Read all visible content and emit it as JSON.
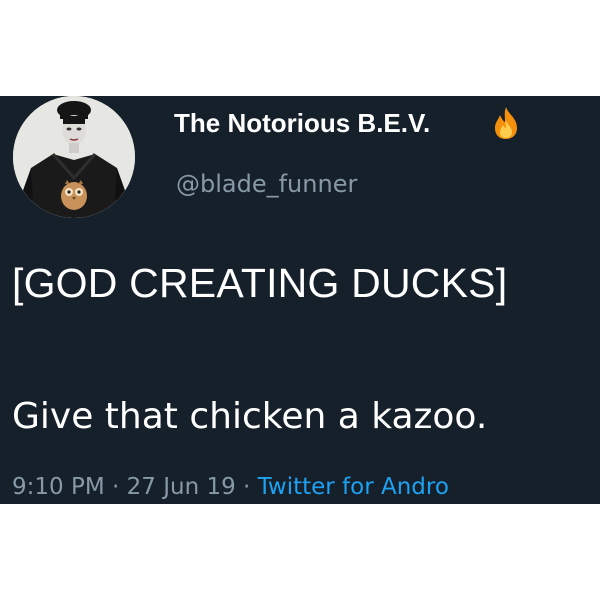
{
  "author": {
    "display_name": "The Notorious B.E.V.",
    "name_emoji": "fire-icon",
    "handle": "@blade_funner",
    "avatar": "profile-avatar"
  },
  "tweet": {
    "line1": "[GOD CREATING DUCKS]",
    "line2": "Give that chicken a kazoo."
  },
  "meta": {
    "time": "9:10 PM",
    "sep1": "·",
    "date": "27 Jun 19",
    "sep2": "·",
    "source": "Twitter for Andro"
  },
  "colors": {
    "background": "#15202b",
    "text": "#ffffff",
    "secondary_text": "#8899a6",
    "link": "#1da1f2"
  }
}
